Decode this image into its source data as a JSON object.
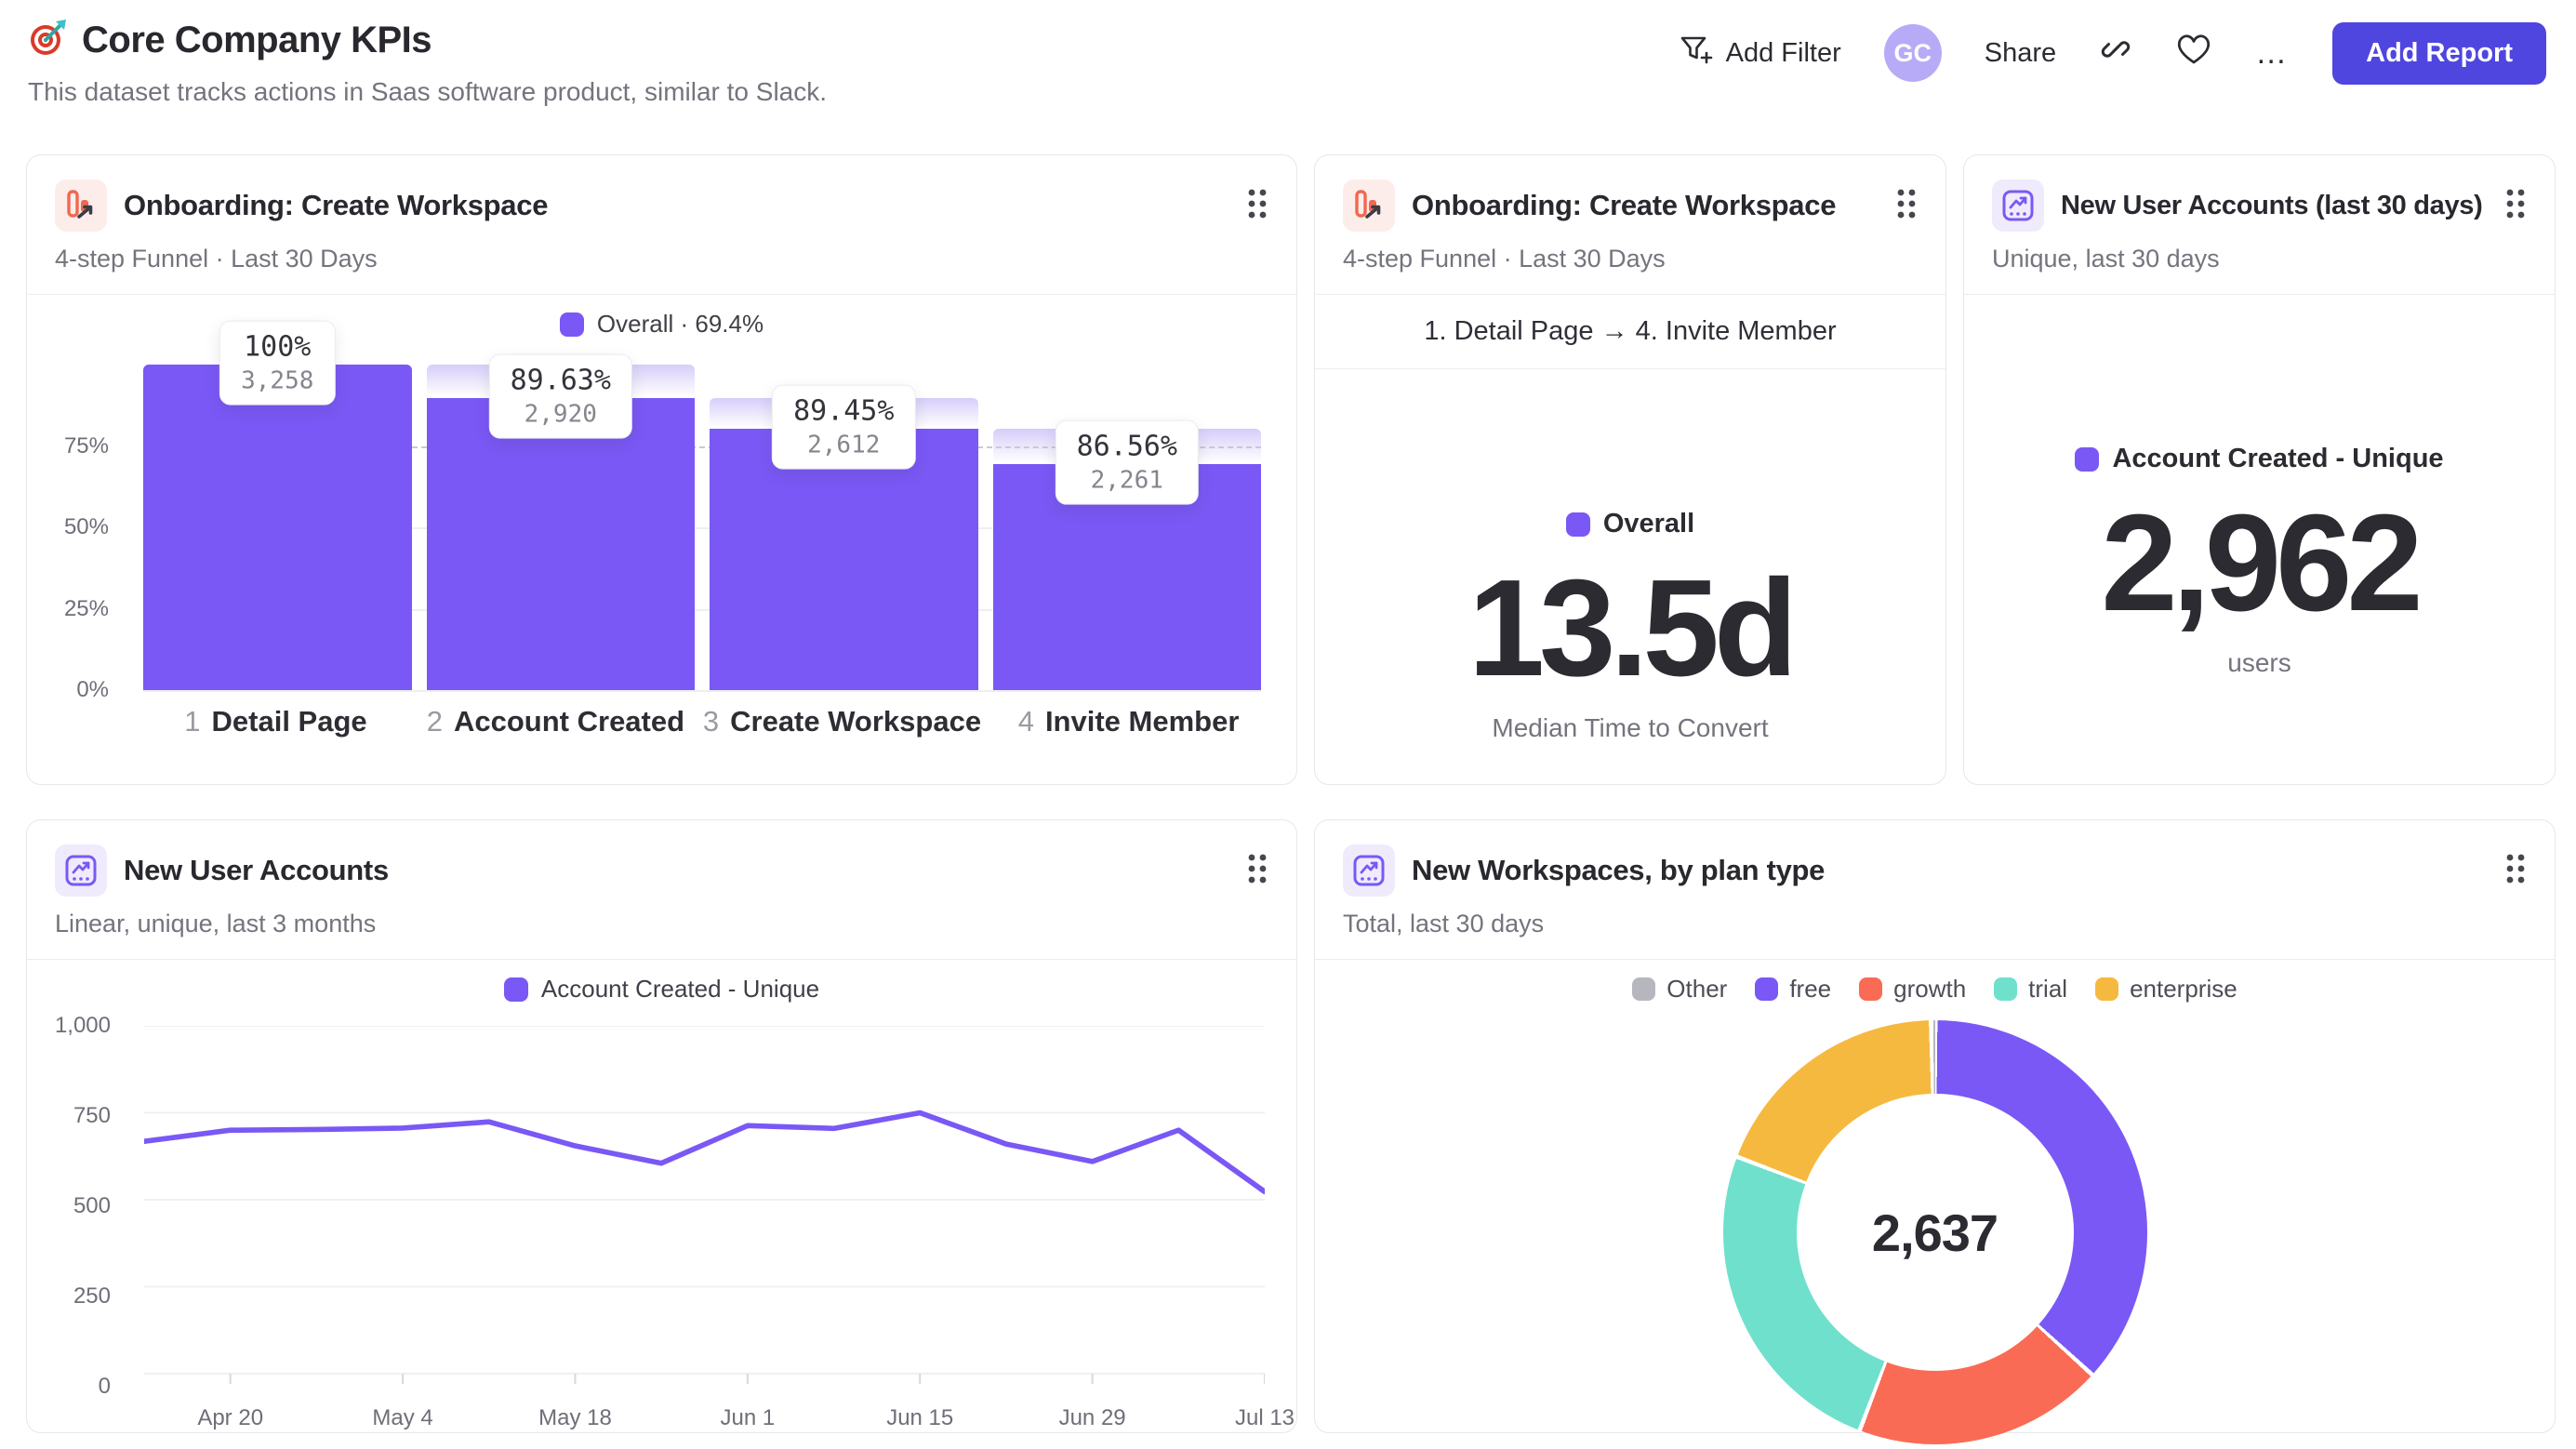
{
  "header": {
    "title": "Core Company KPIs",
    "subtitle": "This dataset tracks actions in Saas software product, similar to Slack.",
    "actions": {
      "add_filter": "Add Filter",
      "avatar_initials": "GC",
      "share": "Share",
      "more": "…",
      "add_report": "Add Report"
    }
  },
  "colors": {
    "accent_purple": "#7a58f5",
    "button_indigo": "#4f46e0",
    "avatar_bg": "#b7abf8",
    "growth_red": "#f96b55",
    "trial_teal": "#6fe0cc",
    "enterprise_yellow": "#f6b93f",
    "other_gray": "#b6b6be",
    "funnel_icon_red": "#f26750",
    "grid_gray": "#efeff2"
  },
  "cards": {
    "funnel": {
      "title": "Onboarding: Create Workspace",
      "subtitle": "4-step Funnel · Last 30 Days",
      "legend": "Overall · 69.4%"
    },
    "time_to_convert": {
      "title": "Onboarding: Create Workspace",
      "subtitle": "4-step Funnel · Last 30 Days",
      "range": "1. Detail Page → 4. Invite Member",
      "legend": "Overall",
      "value": "13.5d",
      "caption": "Median Time to Convert"
    },
    "new_users_30d": {
      "title": "New User Accounts (last 30 days)",
      "subtitle": "Unique, last 30 days",
      "legend": "Account Created - Unique",
      "value": "2,962",
      "caption": "users"
    },
    "new_users_trend": {
      "title": "New User Accounts",
      "subtitle": "Linear, unique, last 3 months",
      "legend": "Account Created - Unique"
    },
    "workspaces": {
      "title": "New Workspaces, by plan type",
      "subtitle": "Total, last 30 days",
      "total": "2,637",
      "legend": [
        {
          "label": "Other",
          "color": "#b6b6be"
        },
        {
          "label": "free",
          "color": "#7a58f5"
        },
        {
          "label": "growth",
          "color": "#f96b55"
        },
        {
          "label": "trial",
          "color": "#6fe0cc"
        },
        {
          "label": "enterprise",
          "color": "#f6b93f"
        }
      ]
    }
  },
  "chart_data": [
    {
      "type": "bar",
      "subtype": "funnel",
      "title": "Onboarding: Create Workspace",
      "legend": "Overall · 69.4%",
      "bar_color": "#7a58f5",
      "y_ticks_pct": [
        75,
        50,
        25,
        0
      ],
      "reference_line_pct": 75,
      "steps": [
        {
          "num": "1",
          "label": "Detail Page",
          "conversion": "100%",
          "count": "3,258",
          "overall_pct": 100
        },
        {
          "num": "2",
          "label": "Account Created",
          "conversion": "89.63%",
          "count": "2,920",
          "overall_pct": 89.63
        },
        {
          "num": "3",
          "label": "Create Workspace",
          "conversion": "89.45%",
          "count": "2,612",
          "overall_pct": 80.17
        },
        {
          "num": "4",
          "label": "Invite Member",
          "conversion": "86.56%",
          "count": "2,261",
          "overall_pct": 69.4
        }
      ]
    },
    {
      "type": "line",
      "title": "New User Accounts",
      "series_name": "Account Created - Unique",
      "line_color": "#7a58f5",
      "x": [
        "Apr 13",
        "Apr 20",
        "Apr 27",
        "May 4",
        "May 11",
        "May 18",
        "May 25",
        "Jun 1",
        "Jun 8",
        "Jun 15",
        "Jun 22",
        "Jun 29",
        "Jul 6",
        "Jul 13"
      ],
      "values": [
        668,
        700,
        702,
        706,
        724,
        655,
        605,
        713,
        705,
        750,
        660,
        610,
        700,
        523
      ],
      "x_tick_indices": [
        1,
        3,
        5,
        7,
        9,
        11,
        13
      ],
      "x_tick_labels": [
        "Apr 20",
        "May 4",
        "May 18",
        "Jun 1",
        "Jun 15",
        "Jun 29",
        "Jul 13"
      ],
      "y_ticks": [
        "1,000",
        "750",
        "500",
        "250",
        "0"
      ],
      "y_tick_values": [
        1000,
        750,
        500,
        250,
        0
      ],
      "ylim": [
        0,
        1000
      ]
    },
    {
      "type": "pie",
      "subtype": "donut",
      "title": "New Workspaces, by plan type",
      "total": 2637,
      "total_label": "2,637",
      "segments": [
        {
          "label": "free",
          "value": 973,
          "color": "#7a58f5"
        },
        {
          "label": "growth",
          "value": 503,
          "color": "#f96b55"
        },
        {
          "label": "trial",
          "value": 659,
          "color": "#6fe0cc"
        },
        {
          "label": "enterprise",
          "value": 498,
          "color": "#f6b93f"
        },
        {
          "label": "Other",
          "value": 4,
          "color": "#b6b6be"
        }
      ],
      "legend_position": "top"
    }
  ]
}
